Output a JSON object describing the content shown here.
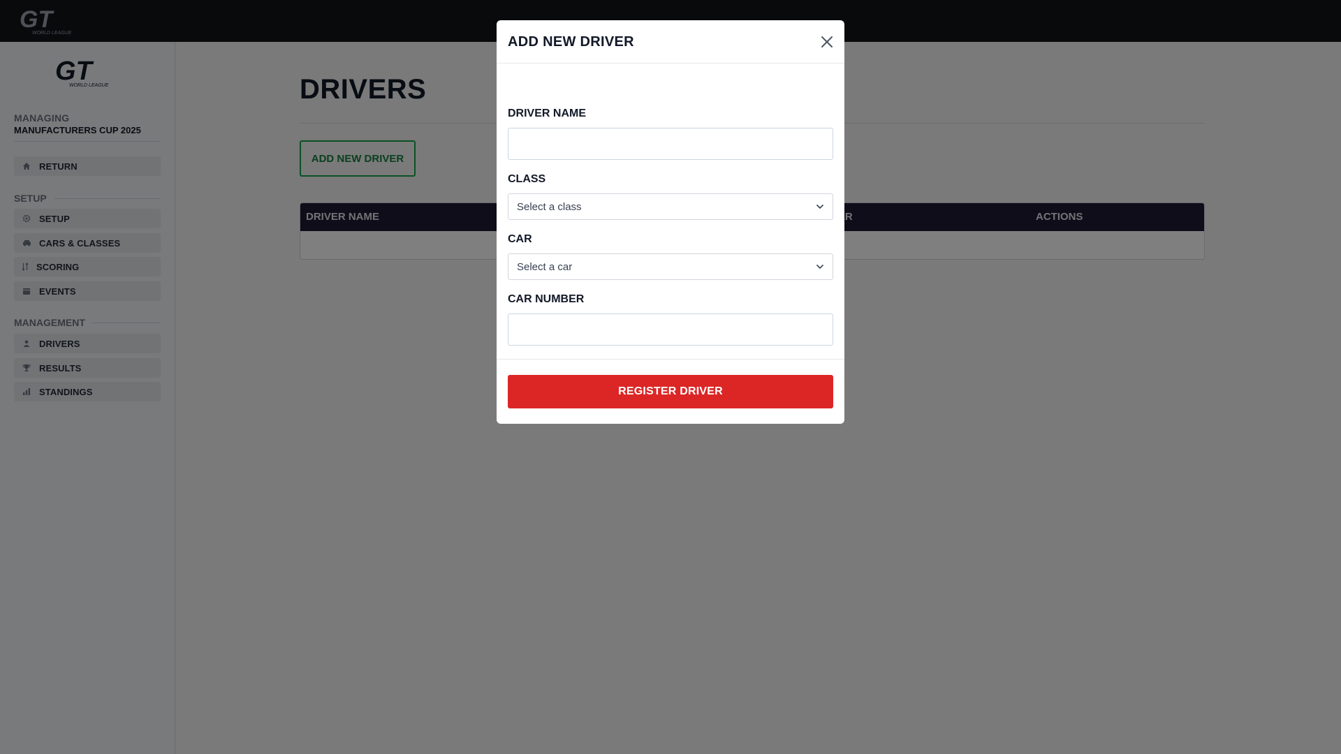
{
  "brand": {
    "logo_text": "GT",
    "logo_subtext": "WORLD LEAGUE"
  },
  "sidebar": {
    "managing_label": "MANAGING",
    "managing_value": "MANUFACTURERS CUP 2025",
    "return_item": {
      "label": "RETURN",
      "icon": "home-icon"
    },
    "setup_section": "SETUP",
    "setup_items": [
      {
        "label": "SETUP",
        "icon": "gear-icon"
      },
      {
        "label": "CARS & CLASSES",
        "icon": "car-icon"
      },
      {
        "label": "SCORING",
        "icon": "sort-icon"
      },
      {
        "label": "EVENTS",
        "icon": "calendar-icon"
      }
    ],
    "management_section": "MANAGEMENT",
    "management_items": [
      {
        "label": "DRIVERS",
        "icon": "user-icon"
      },
      {
        "label": "RESULTS",
        "icon": "trophy-icon"
      },
      {
        "label": "STANDINGS",
        "icon": "bar-chart-icon"
      }
    ]
  },
  "main": {
    "title": "DRIVERS",
    "add_button": "ADD NEW DRIVER",
    "table": {
      "columns": [
        "DRIVER NAME",
        "BER",
        "ACTIONS"
      ]
    }
  },
  "modal": {
    "title": "ADD NEW DRIVER",
    "fields": {
      "driver_name": {
        "label": "DRIVER NAME",
        "value": ""
      },
      "class": {
        "label": "CLASS",
        "value": "Select a class"
      },
      "car": {
        "label": "CAR",
        "value": "Select a car"
      },
      "car_number": {
        "label": "CAR NUMBER",
        "value": ""
      }
    },
    "submit": "REGISTER DRIVER"
  },
  "colors": {
    "topbar": "#111418",
    "table_header": "#1e1b33",
    "accent_green": "#16a34a",
    "accent_red": "#dc2626"
  }
}
